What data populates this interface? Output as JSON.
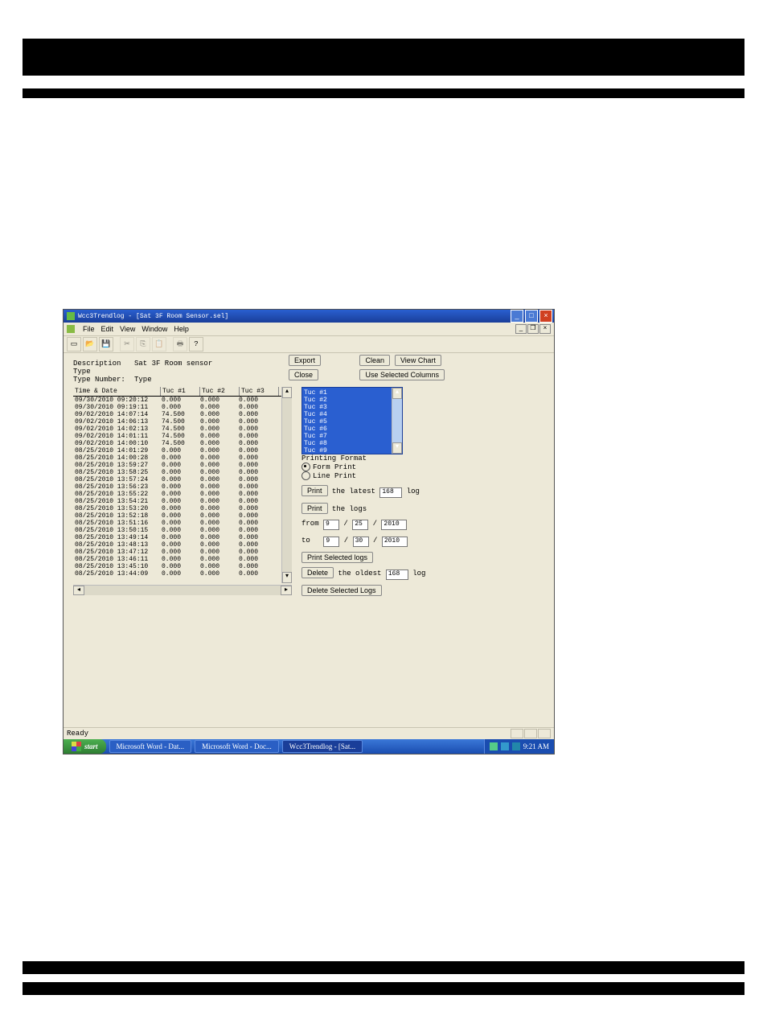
{
  "window": {
    "title": "Wcc3Trendlog - [Sat 3F Room Sensor.sel]",
    "menus": [
      "File",
      "Edit",
      "View",
      "Window",
      "Help"
    ]
  },
  "meta": {
    "description_label": "Description",
    "description_value": "Sat 3F Room sensor",
    "type_label": "Type",
    "type_number_label": "Type Number:",
    "type_number_value": "Type"
  },
  "buttons": {
    "export": "Export",
    "close": "Close",
    "clean": "Clean",
    "view_chart": "View Chart",
    "use_selected_columns": "Use Selected Columns",
    "print": "Print",
    "print2": "Print",
    "print_selected": "Print Selected logs",
    "delete": "Delete",
    "delete_selected": "Delete Selected Logs"
  },
  "table": {
    "headers": [
      "Time & Date",
      "Tuc #1",
      "Tuc #2",
      "Tuc #3"
    ],
    "rows": [
      [
        "09/30/2010 09:20:12",
        "0.000",
        "0.000",
        "0.000"
      ],
      [
        "09/30/2010 09:19:11",
        "0.000",
        "0.000",
        "0.000"
      ],
      [
        "09/02/2010 14:07:14",
        "74.500",
        "0.000",
        "0.000"
      ],
      [
        "09/02/2010 14:06:13",
        "74.500",
        "0.000",
        "0.000"
      ],
      [
        "09/02/2010 14:02:13",
        "74.500",
        "0.000",
        "0.000"
      ],
      [
        "09/02/2010 14:01:11",
        "74.500",
        "0.000",
        "0.000"
      ],
      [
        "09/02/2010 14:00:10",
        "74.500",
        "0.000",
        "0.000"
      ],
      [
        "08/25/2010 14:01:29",
        "0.000",
        "0.000",
        "0.000"
      ],
      [
        "08/25/2010 14:00:28",
        "0.000",
        "0.000",
        "0.000"
      ],
      [
        "08/25/2010 13:59:27",
        "0.000",
        "0.000",
        "0.000"
      ],
      [
        "08/25/2010 13:58:25",
        "0.000",
        "0.000",
        "0.000"
      ],
      [
        "08/25/2010 13:57:24",
        "0.000",
        "0.000",
        "0.000"
      ],
      [
        "08/25/2010 13:56:23",
        "0.000",
        "0.000",
        "0.000"
      ],
      [
        "08/25/2010 13:55:22",
        "0.000",
        "0.000",
        "0.000"
      ],
      [
        "08/25/2010 13:54:21",
        "0.000",
        "0.000",
        "0.000"
      ],
      [
        "08/25/2010 13:53:20",
        "0.000",
        "0.000",
        "0.000"
      ],
      [
        "08/25/2010 13:52:18",
        "0.000",
        "0.000",
        "0.000"
      ],
      [
        "08/25/2010 13:51:16",
        "0.000",
        "0.000",
        "0.000"
      ],
      [
        "08/25/2010 13:50:15",
        "0.000",
        "0.000",
        "0.000"
      ],
      [
        "08/25/2010 13:49:14",
        "0.000",
        "0.000",
        "0.000"
      ],
      [
        "08/25/2010 13:48:13",
        "0.000",
        "0.000",
        "0.000"
      ],
      [
        "08/25/2010 13:47:12",
        "0.000",
        "0.000",
        "0.000"
      ],
      [
        "08/25/2010 13:46:11",
        "0.000",
        "0.000",
        "0.000"
      ],
      [
        "08/25/2010 13:45:10",
        "0.000",
        "0.000",
        "0.000"
      ],
      [
        "08/25/2010 13:44:09",
        "0.000",
        "0.000",
        "0.000"
      ]
    ]
  },
  "tuc_list": [
    "Tuc #1",
    "Tuc #2",
    "Tuc #3",
    "Tuc #4",
    "Tuc #5",
    "Tuc #6",
    "Tuc #7",
    "Tuc #8",
    "Tuc #9"
  ],
  "print_panel": {
    "format_label": "Printing Format",
    "form_print": "Form Print",
    "line_print": "Line Print",
    "the_latest": "the latest",
    "latest_value": "168",
    "log_suffix": "log",
    "the_logs": "the logs",
    "from": "from",
    "to": "to",
    "from_m": "9",
    "from_d": "25",
    "from_y": "2010",
    "to_m": "9",
    "to_d": "30",
    "to_y": "2010",
    "the_oldest": "the oldest",
    "oldest_value": "168"
  },
  "statusbar": {
    "text": "Ready"
  },
  "taskbar": {
    "start": "start",
    "items": [
      "Microsoft Word - Dat...",
      "Microsoft Word - Doc...",
      "Wcc3Trendlog - [Sat..."
    ],
    "time": "9:21 AM"
  }
}
